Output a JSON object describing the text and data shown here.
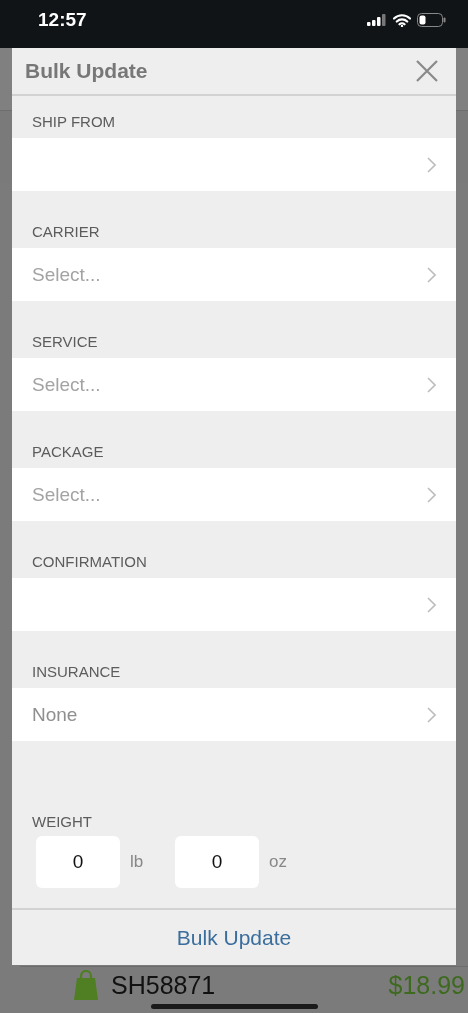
{
  "status_bar": {
    "time": "12:57"
  },
  "background": {
    "order": "SH58871",
    "amount": "$18.99"
  },
  "modal": {
    "title": "Bulk Update",
    "sections": [
      {
        "label": "SHIP FROM"
      },
      {
        "label": "CARRIER",
        "placeholder": "Select..."
      },
      {
        "label": "SERVICE",
        "placeholder": "Select..."
      },
      {
        "label": "PACKAGE",
        "placeholder": "Select..."
      },
      {
        "label": "CONFIRMATION"
      },
      {
        "label": "INSURANCE",
        "value": "None"
      }
    ],
    "weight": {
      "label": "WEIGHT",
      "fields": [
        {
          "value": "0",
          "unit": "lb"
        },
        {
          "value": "0",
          "unit": "oz"
        }
      ]
    },
    "button": "Bulk Update"
  }
}
